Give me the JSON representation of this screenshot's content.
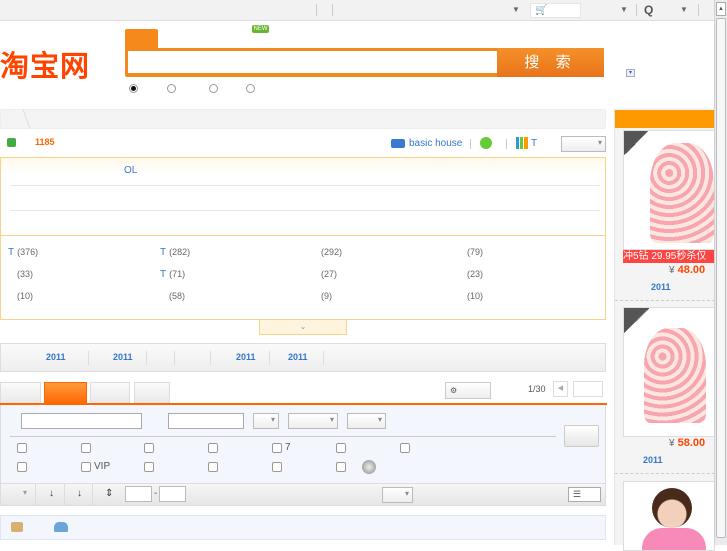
{
  "topbar": {
    "cart_icon": "cart-icon",
    "search_icon_label": "Q"
  },
  "logo": "淘宝网",
  "search": {
    "new_badge": "NEW",
    "button_label": "搜 索",
    "value": "",
    "radio_selected": 0
  },
  "info": {
    "count": "1185",
    "brand_link": "basic house",
    "chart_link": "T"
  },
  "filters": {
    "highlight": "OL",
    "categories": [
      [
        {
          "t": "T",
          "n": "(376)"
        },
        {
          "t": "T",
          "n": "(282)"
        },
        {
          "t": "",
          "n": "(292)"
        },
        {
          "t": "",
          "n": "(79)"
        }
      ],
      [
        {
          "t": "",
          "n": "(33)"
        },
        {
          "t": "T",
          "n": "(71)"
        },
        {
          "t": "",
          "n": "(27)"
        },
        {
          "t": "",
          "n": "(23)"
        }
      ],
      [
        {
          "t": "",
          "n": "(10)"
        },
        {
          "t": "",
          "n": "(58)"
        },
        {
          "t": "",
          "n": "(9)"
        },
        {
          "t": "",
          "n": "(10)"
        }
      ]
    ]
  },
  "years": [
    "2011",
    "2011",
    "2011",
    "2011"
  ],
  "pager": {
    "text": "1/30"
  },
  "checks": {
    "r1c5": "7",
    "r2c2": "VIP"
  },
  "sidebar": {
    "products": [
      {
        "banner": "冲5钻 29.95秒杀仅",
        "currency": "¥",
        "price": "48.00",
        "year": "2011"
      },
      {
        "currency": "¥",
        "price": "58.00",
        "year": "2011"
      }
    ]
  },
  "colors": {
    "accent": "#ff6600",
    "link": "#3377cc"
  }
}
